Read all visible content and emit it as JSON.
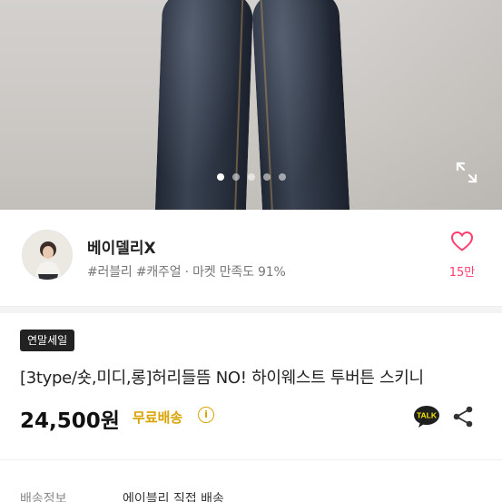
{
  "hero": {
    "slide_count": 5,
    "active_slide": 1
  },
  "seller": {
    "name": "베이델리X",
    "tags": "#러블리 #캐주얼 · 마켓 만족도 91%",
    "likes": "15만"
  },
  "product": {
    "badge": "연말세일",
    "title": "[3type/숏,미디,롱]허리들뜸 NO! 하이웨스트 투버튼 스키니",
    "price": "24,500원",
    "shipping": "무료배송",
    "talk_label": "TALK"
  },
  "delivery": {
    "label": "배송정보",
    "value": "에이블리 직접 배송"
  },
  "colors": {
    "accent": "#ff3d6e",
    "shipping": "#d9a300",
    "badge_bg": "#222222"
  }
}
